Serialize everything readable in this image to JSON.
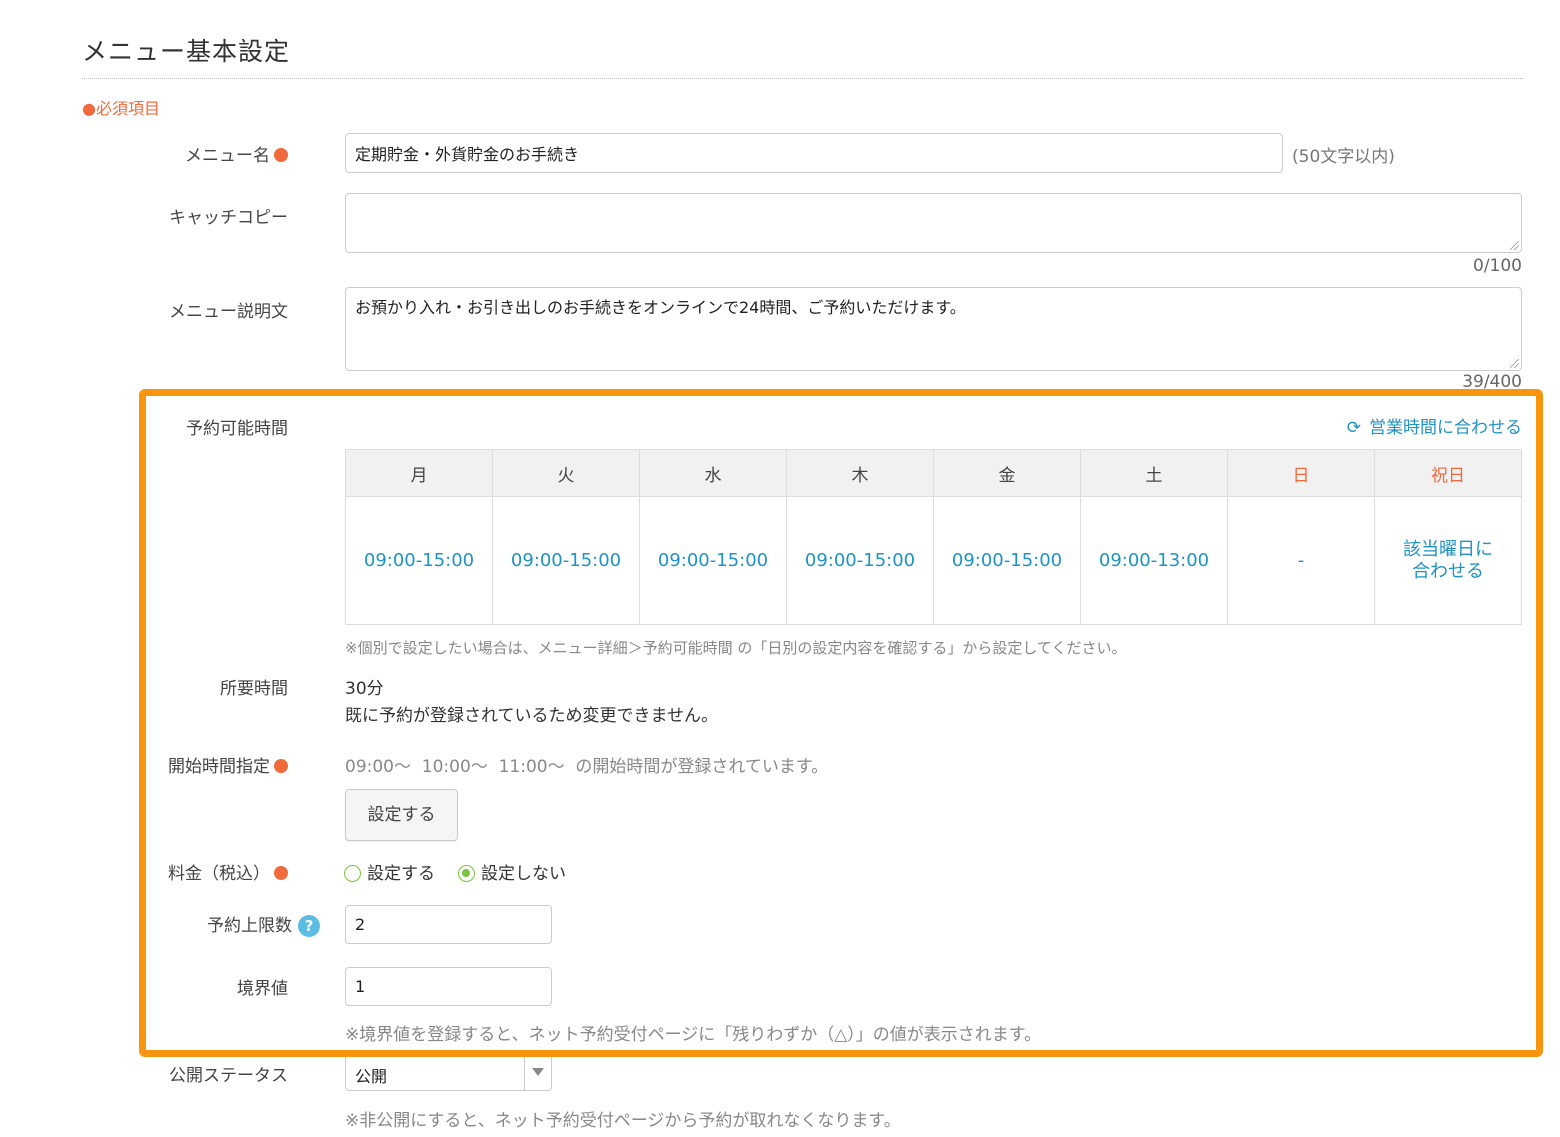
{
  "page_title": "メニュー基本設定",
  "required_note": "●必須項目",
  "menu_name": {
    "label": "メニュー名",
    "value": "定期貯金・外貨貯金のお手続き",
    "hint": "(50文字以内)"
  },
  "catch_copy": {
    "label": "キャッチコピー",
    "value": "",
    "counter": "0/100"
  },
  "description": {
    "label": "メニュー説明文",
    "value": "お預かり入れ・お引き出しのお手続きをオンラインで24時間、ご予約いただけます。",
    "counter": "39/400"
  },
  "reservable_hours": {
    "label": "予約可能時間",
    "sync_link": "営業時間に合わせる",
    "days": [
      "月",
      "火",
      "水",
      "木",
      "金",
      "土",
      "日",
      "祝日"
    ],
    "hours": [
      "09:00-15:00",
      "09:00-15:00",
      "09:00-15:00",
      "09:00-15:00",
      "09:00-15:00",
      "09:00-13:00",
      "-"
    ],
    "holiday_line1": "該当曜日に",
    "holiday_line2": "合わせる",
    "note": "※個別で設定したい場合は、メニュー詳細＞予約可能時間 の「日別の設定内容を確認する」から設定してください。"
  },
  "duration": {
    "label": "所要時間",
    "value": "30分",
    "note": "既に予約が登録されているため変更できません。"
  },
  "start_time": {
    "label": "開始時間指定",
    "text": "09:00〜  10:00〜  11:00〜  の開始時間が登録されています。",
    "button": "設定する"
  },
  "price": {
    "label": "料金（税込）",
    "option_set": "設定する",
    "option_unset": "設定しない",
    "selected": "設定しない"
  },
  "limit": {
    "label": "予約上限数",
    "value": "2"
  },
  "threshold": {
    "label": "境界値",
    "value": "1",
    "note": "※境界値を登録すると、ネット予約受付ページに「残りわずか（△）」の値が表示されます。"
  },
  "status": {
    "label": "公開ステータス",
    "value": "公開",
    "note": "※非公開にすると、ネット予約受付ページから予約が取れなくなります。"
  },
  "colors": {
    "accent_orange": "#f7960e",
    "required_red": "#f06a3c",
    "link_blue": "#1f93c4",
    "radio_green": "#7dc242"
  }
}
